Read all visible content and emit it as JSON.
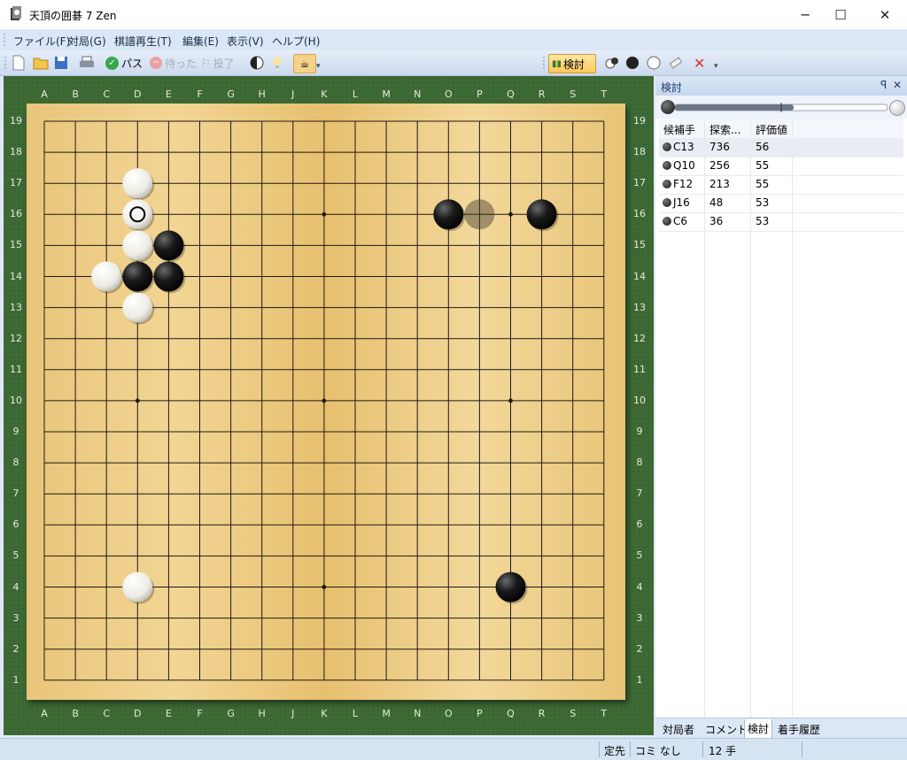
{
  "window": {
    "title": "天頂の囲碁 7 Zen",
    "minimize": "─",
    "maximize": "☐",
    "close": "✕"
  },
  "menu": [
    "ファイル(F)",
    "対局(G)",
    "棋譜再生(T)",
    "編集(E)",
    "表示(V)",
    "ヘルプ(H)"
  ],
  "toolbar": {
    "pass": "パス",
    "wait": "待った",
    "resign": "投了",
    "analyze": "検討"
  },
  "board": {
    "columns": [
      "A",
      "B",
      "C",
      "D",
      "E",
      "F",
      "G",
      "H",
      "J",
      "K",
      "L",
      "M",
      "N",
      "O",
      "P",
      "Q",
      "R",
      "S",
      "T"
    ],
    "rows": [
      "19",
      "18",
      "17",
      "16",
      "15",
      "14",
      "13",
      "12",
      "11",
      "10",
      "9",
      "8",
      "7",
      "6",
      "5",
      "4",
      "3",
      "2",
      "1"
    ],
    "stones": [
      {
        "point": "D17",
        "color": "white"
      },
      {
        "point": "D16",
        "color": "white",
        "last_move": true
      },
      {
        "point": "D15",
        "color": "white"
      },
      {
        "point": "E15",
        "color": "black"
      },
      {
        "point": "C14",
        "color": "white"
      },
      {
        "point": "D14",
        "color": "black"
      },
      {
        "point": "E14",
        "color": "black"
      },
      {
        "point": "D13",
        "color": "white"
      },
      {
        "point": "O16",
        "color": "black"
      },
      {
        "point": "R16",
        "color": "black"
      },
      {
        "point": "D4",
        "color": "white"
      },
      {
        "point": "Q4",
        "color": "black"
      }
    ],
    "hint": {
      "point": "P16",
      "color": "black-ghost"
    },
    "hoshi": [
      "D16",
      "K16",
      "Q16",
      "D10",
      "K10",
      "Q10",
      "D4",
      "K4",
      "Q4"
    ]
  },
  "panel": {
    "title": "検討",
    "pin": "ꟼ",
    "close": "✕",
    "columns": [
      "候補手",
      "探索...",
      "評価値"
    ],
    "candidates": [
      {
        "move": "C13",
        "visits": "736",
        "score": "56"
      },
      {
        "move": "Q10",
        "visits": "256",
        "score": "55"
      },
      {
        "move": "F12",
        "visits": "213",
        "score": "55"
      },
      {
        "move": "J16",
        "visits": "48",
        "score": "53"
      },
      {
        "move": "C6",
        "visits": "36",
        "score": "53"
      }
    ],
    "tabs": [
      "対局者",
      "コメント",
      "検討",
      "着手履歴"
    ]
  },
  "status": {
    "handicap": "定先",
    "komi": "コミ なし",
    "moves": "12 手"
  }
}
